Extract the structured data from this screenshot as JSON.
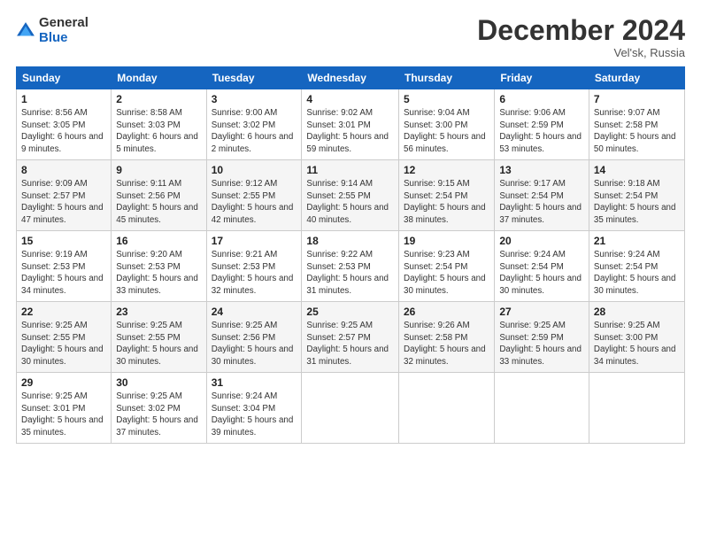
{
  "logo": {
    "general": "General",
    "blue": "Blue"
  },
  "title": "December 2024",
  "location": "Vel'sk, Russia",
  "days_header": [
    "Sunday",
    "Monday",
    "Tuesday",
    "Wednesday",
    "Thursday",
    "Friday",
    "Saturday"
  ],
  "weeks": [
    [
      {
        "day": "1",
        "sunrise": "8:56 AM",
        "sunset": "3:05 PM",
        "daylight": "6 hours and 9 minutes."
      },
      {
        "day": "2",
        "sunrise": "8:58 AM",
        "sunset": "3:03 PM",
        "daylight": "6 hours and 5 minutes."
      },
      {
        "day": "3",
        "sunrise": "9:00 AM",
        "sunset": "3:02 PM",
        "daylight": "6 hours and 2 minutes."
      },
      {
        "day": "4",
        "sunrise": "9:02 AM",
        "sunset": "3:01 PM",
        "daylight": "5 hours and 59 minutes."
      },
      {
        "day": "5",
        "sunrise": "9:04 AM",
        "sunset": "3:00 PM",
        "daylight": "5 hours and 56 minutes."
      },
      {
        "day": "6",
        "sunrise": "9:06 AM",
        "sunset": "2:59 PM",
        "daylight": "5 hours and 53 minutes."
      },
      {
        "day": "7",
        "sunrise": "9:07 AM",
        "sunset": "2:58 PM",
        "daylight": "5 hours and 50 minutes."
      }
    ],
    [
      {
        "day": "8",
        "sunrise": "9:09 AM",
        "sunset": "2:57 PM",
        "daylight": "5 hours and 47 minutes."
      },
      {
        "day": "9",
        "sunrise": "9:11 AM",
        "sunset": "2:56 PM",
        "daylight": "5 hours and 45 minutes."
      },
      {
        "day": "10",
        "sunrise": "9:12 AM",
        "sunset": "2:55 PM",
        "daylight": "5 hours and 42 minutes."
      },
      {
        "day": "11",
        "sunrise": "9:14 AM",
        "sunset": "2:55 PM",
        "daylight": "5 hours and 40 minutes."
      },
      {
        "day": "12",
        "sunrise": "9:15 AM",
        "sunset": "2:54 PM",
        "daylight": "5 hours and 38 minutes."
      },
      {
        "day": "13",
        "sunrise": "9:17 AM",
        "sunset": "2:54 PM",
        "daylight": "5 hours and 37 minutes."
      },
      {
        "day": "14",
        "sunrise": "9:18 AM",
        "sunset": "2:54 PM",
        "daylight": "5 hours and 35 minutes."
      }
    ],
    [
      {
        "day": "15",
        "sunrise": "9:19 AM",
        "sunset": "2:53 PM",
        "daylight": "5 hours and 34 minutes."
      },
      {
        "day": "16",
        "sunrise": "9:20 AM",
        "sunset": "2:53 PM",
        "daylight": "5 hours and 33 minutes."
      },
      {
        "day": "17",
        "sunrise": "9:21 AM",
        "sunset": "2:53 PM",
        "daylight": "5 hours and 32 minutes."
      },
      {
        "day": "18",
        "sunrise": "9:22 AM",
        "sunset": "2:53 PM",
        "daylight": "5 hours and 31 minutes."
      },
      {
        "day": "19",
        "sunrise": "9:23 AM",
        "sunset": "2:54 PM",
        "daylight": "5 hours and 30 minutes."
      },
      {
        "day": "20",
        "sunrise": "9:24 AM",
        "sunset": "2:54 PM",
        "daylight": "5 hours and 30 minutes."
      },
      {
        "day": "21",
        "sunrise": "9:24 AM",
        "sunset": "2:54 PM",
        "daylight": "5 hours and 30 minutes."
      }
    ],
    [
      {
        "day": "22",
        "sunrise": "9:25 AM",
        "sunset": "2:55 PM",
        "daylight": "5 hours and 30 minutes."
      },
      {
        "day": "23",
        "sunrise": "9:25 AM",
        "sunset": "2:55 PM",
        "daylight": "5 hours and 30 minutes."
      },
      {
        "day": "24",
        "sunrise": "9:25 AM",
        "sunset": "2:56 PM",
        "daylight": "5 hours and 30 minutes."
      },
      {
        "day": "25",
        "sunrise": "9:25 AM",
        "sunset": "2:57 PM",
        "daylight": "5 hours and 31 minutes."
      },
      {
        "day": "26",
        "sunrise": "9:26 AM",
        "sunset": "2:58 PM",
        "daylight": "5 hours and 32 minutes."
      },
      {
        "day": "27",
        "sunrise": "9:25 AM",
        "sunset": "2:59 PM",
        "daylight": "5 hours and 33 minutes."
      },
      {
        "day": "28",
        "sunrise": "9:25 AM",
        "sunset": "3:00 PM",
        "daylight": "5 hours and 34 minutes."
      }
    ],
    [
      {
        "day": "29",
        "sunrise": "9:25 AM",
        "sunset": "3:01 PM",
        "daylight": "5 hours and 35 minutes."
      },
      {
        "day": "30",
        "sunrise": "9:25 AM",
        "sunset": "3:02 PM",
        "daylight": "5 hours and 37 minutes."
      },
      {
        "day": "31",
        "sunrise": "9:24 AM",
        "sunset": "3:04 PM",
        "daylight": "5 hours and 39 minutes."
      },
      null,
      null,
      null,
      null
    ]
  ]
}
